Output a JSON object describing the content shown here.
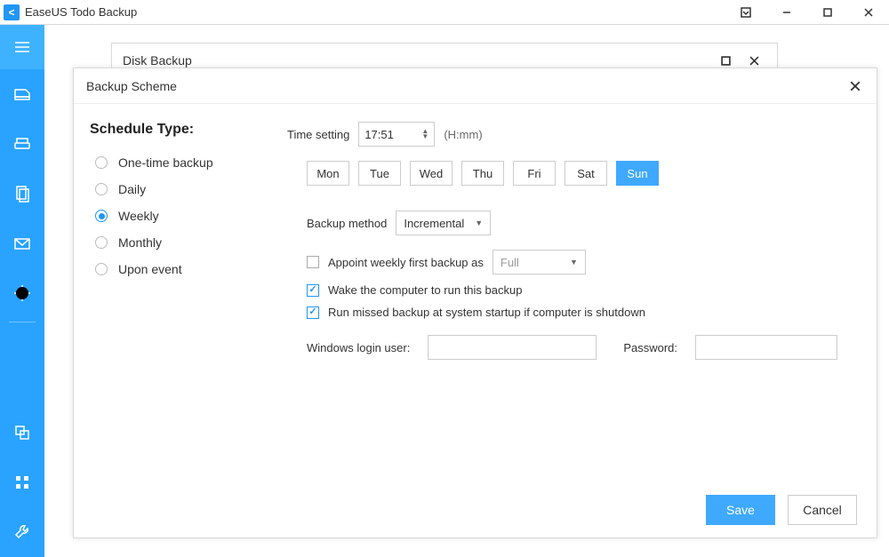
{
  "titlebar": {
    "app_name": "EaseUS Todo Backup"
  },
  "back_window": {
    "title": "Disk Backup"
  },
  "modal": {
    "title": "Backup Scheme",
    "schedule_type_heading": "Schedule Type:",
    "schedule_types": {
      "one_time": "One-time backup",
      "daily": "Daily",
      "weekly": "Weekly",
      "monthly": "Monthly",
      "upon_event": "Upon event"
    },
    "selected_schedule": "weekly",
    "time_setting_label": "Time setting",
    "time_value": "17:51",
    "time_hint": "(H:mm)",
    "days": [
      "Mon",
      "Tue",
      "Wed",
      "Thu",
      "Fri",
      "Sat",
      "Sun"
    ],
    "selected_day": "Sun",
    "backup_method_label": "Backup method",
    "backup_method_value": "Incremental",
    "appoint_label": "Appoint weekly first backup as",
    "appoint_checked": false,
    "appoint_value": "Full",
    "wake_label": "Wake the computer to run this backup",
    "wake_checked": true,
    "run_missed_label": "Run missed backup at system startup if computer is shutdown",
    "run_missed_checked": true,
    "login_user_label": "Windows login user:",
    "password_label": "Password:",
    "login_user_value": "",
    "password_value": "",
    "save_label": "Save",
    "cancel_label": "Cancel"
  }
}
